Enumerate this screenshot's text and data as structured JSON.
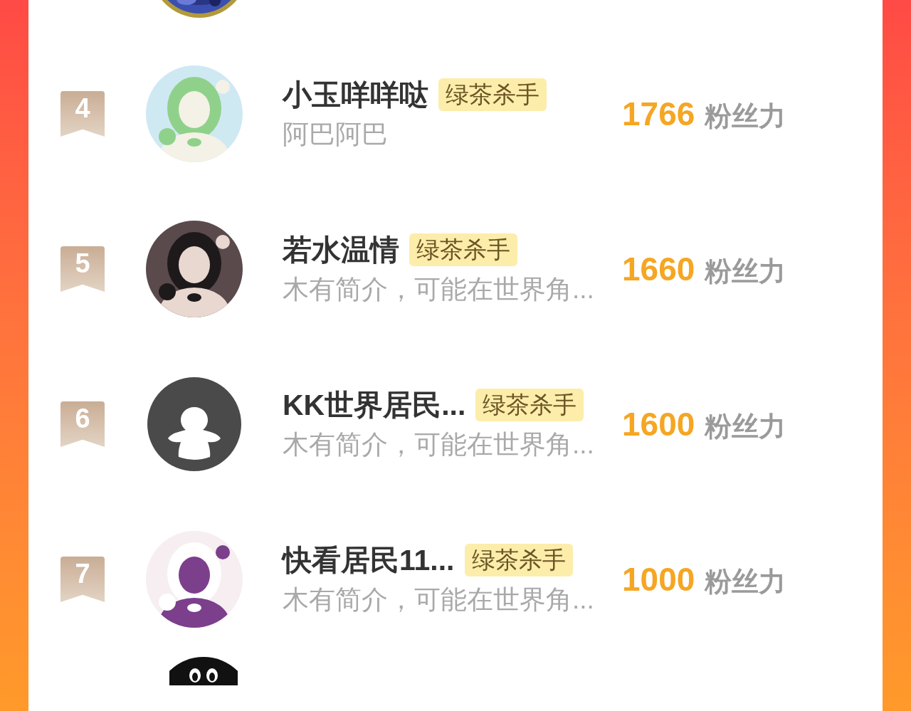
{
  "rows": [
    {
      "rank": "4",
      "kind": "picture",
      "name": "小玉咩咩哒",
      "tag": "绿茶杀手",
      "bio": "阿巴阿巴",
      "score": "1766",
      "unit": "粉丝力"
    },
    {
      "rank": "5",
      "kind": "picture",
      "name": "若水温情",
      "tag": "绿茶杀手",
      "bio": "木有简介，可能在世界角...",
      "score": "1660",
      "unit": "粉丝力"
    },
    {
      "rank": "6",
      "kind": "default",
      "name": "KK世界居民...",
      "tag": "绿茶杀手",
      "bio": "木有简介，可能在世界角...",
      "score": "1600",
      "unit": "粉丝力"
    },
    {
      "rank": "7",
      "kind": "picture",
      "name": "快看居民11...",
      "tag": "绿茶杀手",
      "bio": "木有简介，可能在世界角...",
      "score": "1000",
      "unit": "粉丝力"
    }
  ]
}
